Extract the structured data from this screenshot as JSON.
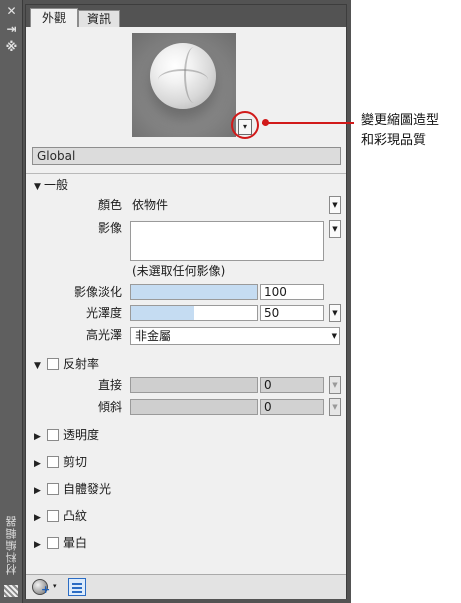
{
  "palette": {
    "title": "材料編輯器",
    "close_glyph": "✕",
    "autohide_glyph": "⇥",
    "properties_glyph": "※"
  },
  "tabs": [
    {
      "label": "外觀",
      "active": true
    },
    {
      "label": "資訊",
      "active": false
    }
  ],
  "preview": {
    "thumbnail": "material-sphere-preview",
    "dropdown_glyph": "▾"
  },
  "material_name": "Global",
  "sections": {
    "generic": {
      "title": "一般",
      "expanded": true,
      "color_label": "顏色",
      "color_value": "依物件",
      "image_label": "影像",
      "image_note": "(未選取任何影像)",
      "image_fade_label": "影像淡化",
      "image_fade_value": "100",
      "image_fade_fraction": 1.0,
      "glossiness_label": "光澤度",
      "glossiness_value": "50",
      "glossiness_fraction": 0.5,
      "highlights_label": "高光澤",
      "highlights_value": "非金屬"
    },
    "reflectivity": {
      "title": "反射率",
      "expanded": true,
      "direct_label": "直接",
      "direct_value": "0",
      "oblique_label": "傾斜",
      "oblique_value": "0"
    },
    "transparency": {
      "title": "透明度",
      "expanded": false
    },
    "cutouts": {
      "title": "剪切",
      "expanded": false
    },
    "self_illumination": {
      "title": "自體發光",
      "expanded": false
    },
    "bump": {
      "title": "凸紋",
      "expanded": false
    },
    "tint": {
      "title": "暈白",
      "expanded": false
    }
  },
  "glyphs": {
    "expanded": "▼",
    "collapsed": "▶",
    "dropdown": "▼",
    "plus": "+",
    "small_arrow": "▾"
  },
  "callout": {
    "line1": "變更縮圖造型",
    "line2": "和彩現品質",
    "color": "#d11a1a"
  },
  "colors": {
    "panel_bg": "#f0f0f0",
    "frame_bg": "#535353",
    "slider_fill": "#c5dcf2",
    "accent": "#2b6cc4"
  }
}
